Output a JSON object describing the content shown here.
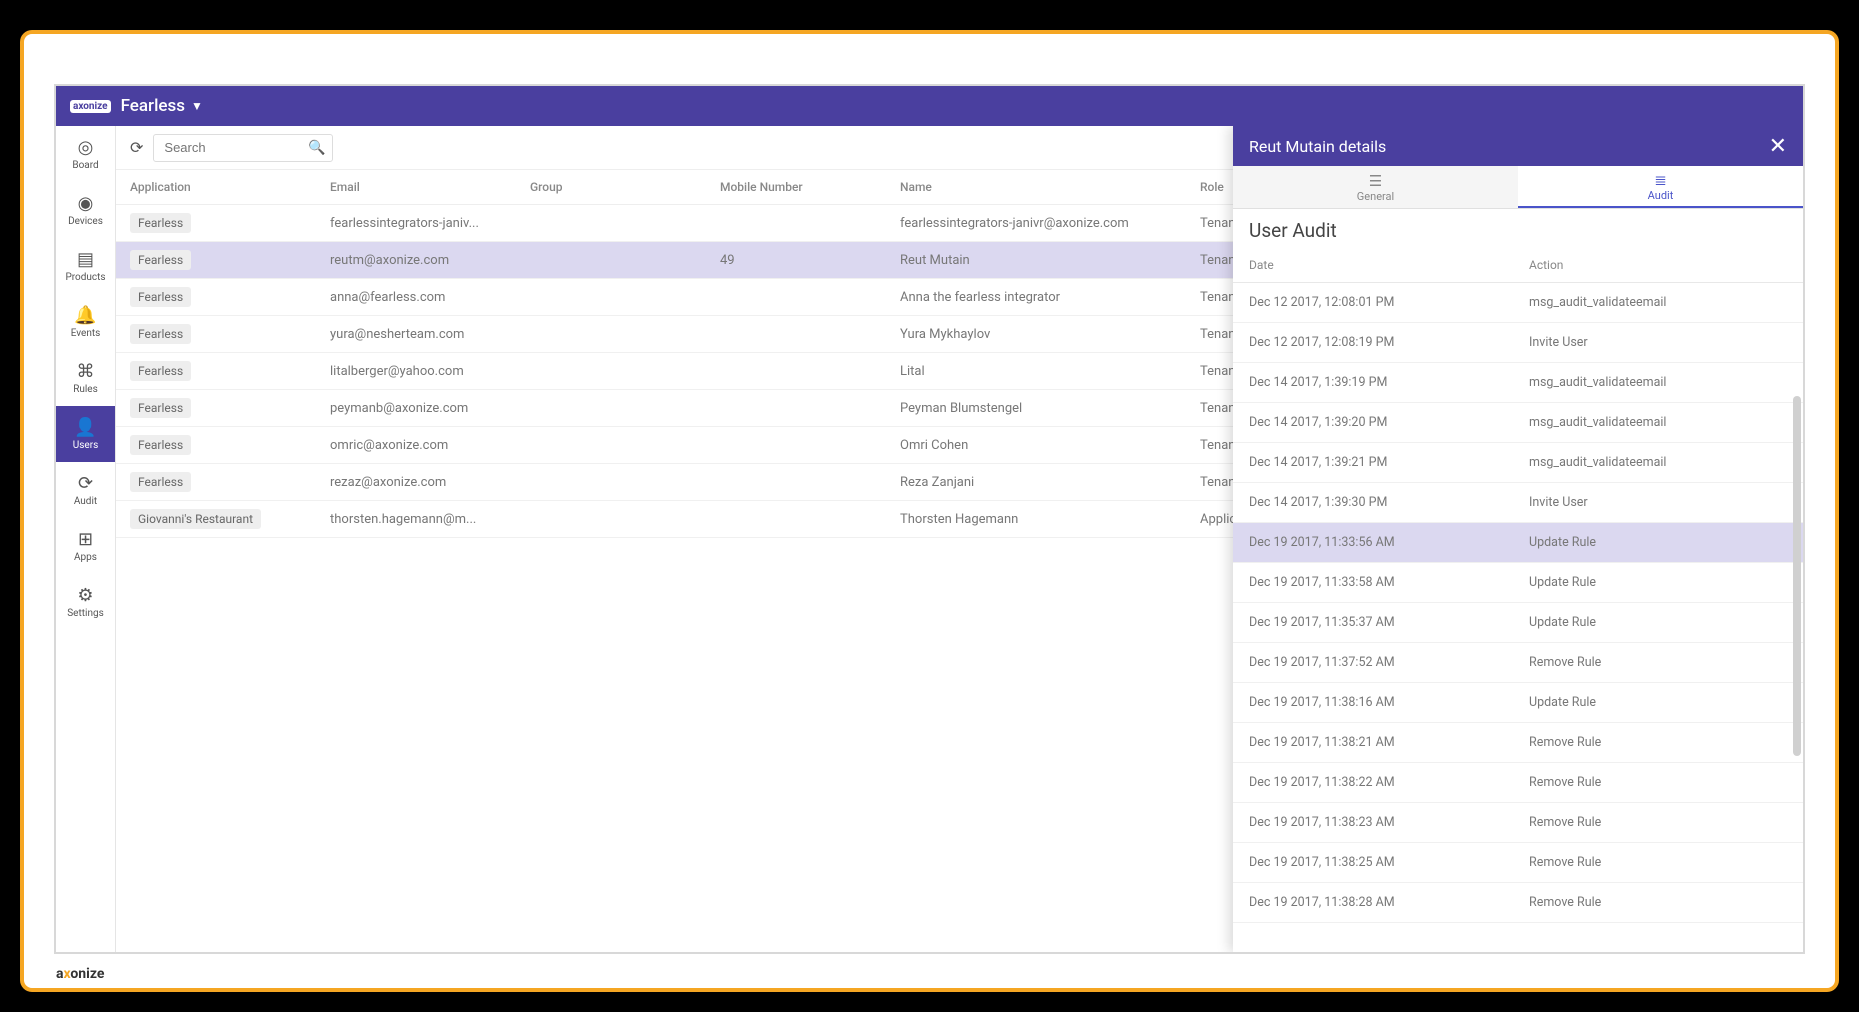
{
  "topbar": {
    "brand": "axonize",
    "org": "Fearless"
  },
  "footer_brand": {
    "pre": "a",
    "dot": "x",
    "post": "onize"
  },
  "sidenav": {
    "items": [
      {
        "icon": "◎",
        "label": "Board"
      },
      {
        "icon": "◉",
        "label": "Devices"
      },
      {
        "icon": "▤",
        "label": "Products"
      },
      {
        "icon": "🔔",
        "label": "Events"
      },
      {
        "icon": "⌘",
        "label": "Rules"
      },
      {
        "icon": "👤",
        "label": "Users"
      },
      {
        "icon": "⟳",
        "label": "Audit"
      },
      {
        "icon": "⊞",
        "label": "Apps"
      },
      {
        "icon": "⚙",
        "label": "Settings"
      }
    ],
    "active_index": 5
  },
  "toolbar": {
    "search_placeholder": "Search"
  },
  "users": {
    "columns": [
      "Application",
      "Email",
      "Group",
      "Mobile Number",
      "Name",
      "Role"
    ],
    "selected_index": 1,
    "rows": [
      {
        "app": "Fearless",
        "email": "fearlessintegrators-janiv...",
        "group": "",
        "mobile": "",
        "name": "fearlessintegrators-janivr@axonize.com",
        "role": "Tenant ad"
      },
      {
        "app": "Fearless",
        "email": "reutm@axonize.com",
        "group": "",
        "mobile": "49",
        "name": "Reut Mutain",
        "role": "Tenant ad"
      },
      {
        "app": "Fearless",
        "email": "anna@fearless.com",
        "group": "",
        "mobile": "",
        "name": "Anna the fearless integrator",
        "role": "Tenant ad"
      },
      {
        "app": "Fearless",
        "email": "yura@nesherteam.com",
        "group": "",
        "mobile": "",
        "name": "Yura Mykhaylov",
        "role": "Tenant ad"
      },
      {
        "app": "Fearless",
        "email": "litalberger@yahoo.com",
        "group": "",
        "mobile": "",
        "name": "Lital",
        "role": "Tenant ad"
      },
      {
        "app": "Fearless",
        "email": "peymanb@axonize.com",
        "group": "",
        "mobile": "",
        "name": "Peyman Blumstengel",
        "role": "Tenant ad"
      },
      {
        "app": "Fearless",
        "email": "omric@axonize.com",
        "group": "",
        "mobile": "",
        "name": "Omri Cohen",
        "role": "Tenant ad"
      },
      {
        "app": "Fearless",
        "email": "rezaz@axonize.com",
        "group": "",
        "mobile": "",
        "name": "Reza Zanjani",
        "role": "Tenant ad"
      },
      {
        "app": "Giovanni's Restaurant",
        "email": "thorsten.hagemann@m...",
        "group": "",
        "mobile": "",
        "name": "Thorsten Hagemann",
        "role": "Applicatio"
      }
    ]
  },
  "details": {
    "title": "Reut Mutain details",
    "tabs": [
      {
        "icon": "☰",
        "label": "General"
      },
      {
        "icon": "≣",
        "label": "Audit"
      }
    ],
    "active_tab": 1,
    "section_title": "User Audit",
    "columns": [
      "Date",
      "Action"
    ],
    "highlight_index": 6,
    "rows": [
      {
        "date": "Dec 12 2017, 12:08:01 PM",
        "action": "msg_audit_validateemail"
      },
      {
        "date": "Dec 12 2017, 12:08:19 PM",
        "action": "Invite User"
      },
      {
        "date": "Dec 14 2017, 1:39:19 PM",
        "action": "msg_audit_validateemail"
      },
      {
        "date": "Dec 14 2017, 1:39:20 PM",
        "action": "msg_audit_validateemail"
      },
      {
        "date": "Dec 14 2017, 1:39:21 PM",
        "action": "msg_audit_validateemail"
      },
      {
        "date": "Dec 14 2017, 1:39:30 PM",
        "action": "Invite User"
      },
      {
        "date": "Dec 19 2017, 11:33:56 AM",
        "action": "Update Rule"
      },
      {
        "date": "Dec 19 2017, 11:33:58 AM",
        "action": "Update Rule"
      },
      {
        "date": "Dec 19 2017, 11:35:37 AM",
        "action": "Update Rule"
      },
      {
        "date": "Dec 19 2017, 11:37:52 AM",
        "action": "Remove Rule"
      },
      {
        "date": "Dec 19 2017, 11:38:16 AM",
        "action": "Update Rule"
      },
      {
        "date": "Dec 19 2017, 11:38:21 AM",
        "action": "Remove Rule"
      },
      {
        "date": "Dec 19 2017, 11:38:22 AM",
        "action": "Remove Rule"
      },
      {
        "date": "Dec 19 2017, 11:38:23 AM",
        "action": "Remove Rule"
      },
      {
        "date": "Dec 19 2017, 11:38:25 AM",
        "action": "Remove Rule"
      },
      {
        "date": "Dec 19 2017, 11:38:28 AM",
        "action": "Remove Rule"
      }
    ]
  }
}
